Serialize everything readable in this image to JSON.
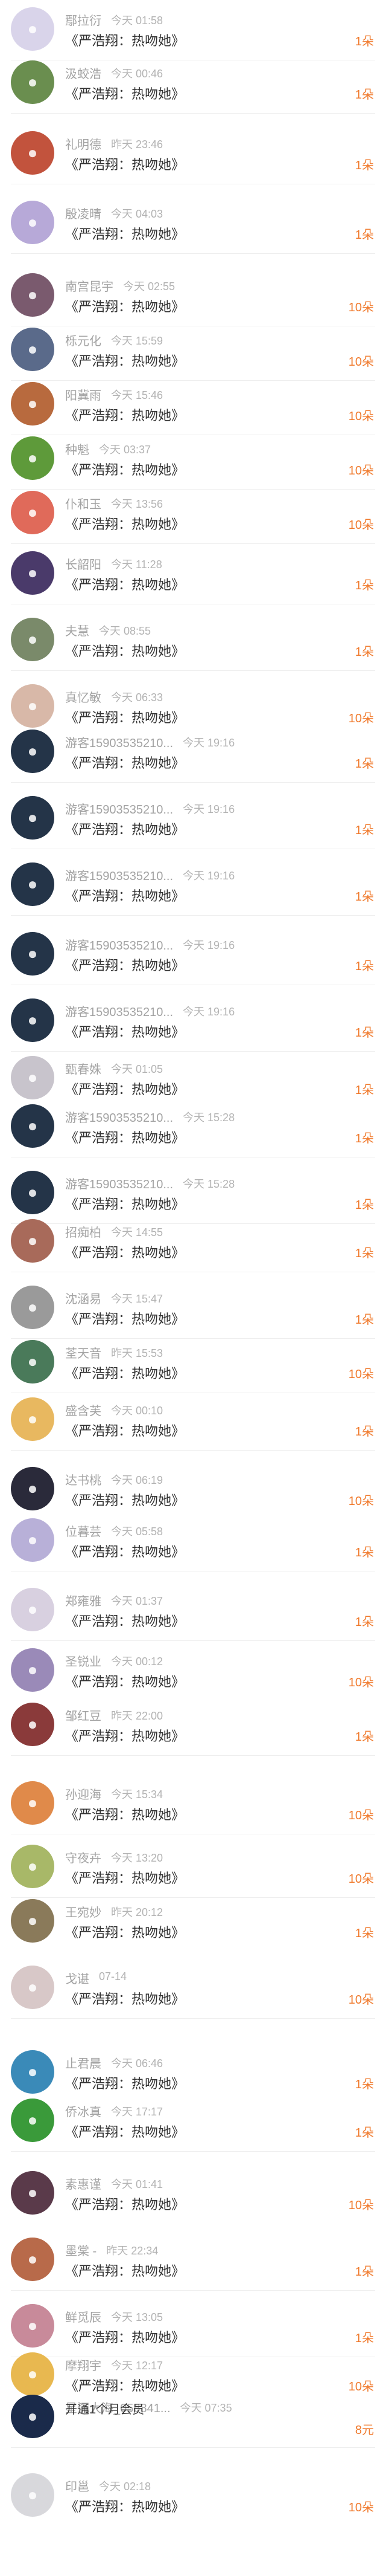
{
  "accent_color": "#f07a2d",
  "rows": [
    {
      "name": "鄢拉衍",
      "time": "今天 01:58",
      "gift": "《严浩翔：热吻她》",
      "amount": "1朵",
      "avatar_color": "#d9d4ea",
      "avatar_icon": "user-avatar"
    },
    {
      "name": "汲蛟浩",
      "time": "今天 00:46",
      "gift": "《严浩翔：热吻她》",
      "amount": "1朵",
      "avatar_color": "#6a8e4f",
      "avatar_icon": "user-avatar"
    },
    {
      "name": "礼明德",
      "time": "昨天 23:46",
      "gift": "《严浩翔：热吻她》",
      "amount": "1朵",
      "avatar_color": "#c2533d",
      "avatar_icon": "user-avatar"
    },
    {
      "name": "殷凌晴",
      "time": "今天 04:03",
      "gift": "《严浩翔：热吻她》",
      "amount": "1朵",
      "avatar_color": "#b7a9d8",
      "avatar_icon": "user-avatar"
    },
    {
      "name": "南宫昆宇",
      "time": "今天 02:55",
      "gift": "《严浩翔：热吻她》",
      "amount": "10朵",
      "avatar_color": "#7a5a6e",
      "avatar_icon": "user-avatar"
    },
    {
      "name": "栎元化",
      "time": "今天 15:59",
      "gift": "《严浩翔：热吻她》",
      "amount": "10朵",
      "avatar_color": "#5a6a8a",
      "avatar_icon": "user-avatar"
    },
    {
      "name": "阳冀雨",
      "time": "今天 15:46",
      "gift": "《严浩翔：热吻她》",
      "amount": "10朵",
      "avatar_color": "#b86a3e",
      "avatar_icon": "user-avatar"
    },
    {
      "name": "种魁",
      "time": "今天 03:37",
      "gift": "《严浩翔：热吻她》",
      "amount": "10朵",
      "avatar_color": "#5e9a3a",
      "avatar_icon": "user-avatar"
    },
    {
      "name": "仆和玉",
      "time": "今天 13:56",
      "gift": "《严浩翔：热吻她》",
      "amount": "10朵",
      "avatar_color": "#e06a5a",
      "avatar_icon": "user-avatar"
    },
    {
      "name": "长韶阳",
      "time": "今天 11:28",
      "gift": "《严浩翔：热吻她》",
      "amount": "1朵",
      "avatar_color": "#4a3a6a",
      "avatar_icon": "user-avatar"
    },
    {
      "name": "夫慧",
      "time": "今天 08:55",
      "gift": "《严浩翔：热吻她》",
      "amount": "1朵",
      "avatar_color": "#7a8a6a",
      "avatar_icon": "user-avatar"
    },
    {
      "name": "真忆敏",
      "time": "今天 06:33",
      "gift": "《严浩翔：热吻她》",
      "amount": "10朵",
      "avatar_color": "#d8b8a8",
      "avatar_icon": "user-avatar"
    },
    {
      "name": "游客15903535210...",
      "time": "今天 19:16",
      "gift": "《严浩翔：热吻她》",
      "amount": "1朵",
      "avatar_color": "#243448",
      "avatar_icon": "user-avatar"
    },
    {
      "name": "游客15903535210...",
      "time": "今天 19:16",
      "gift": "《严浩翔：热吻她》",
      "amount": "1朵",
      "avatar_color": "#243448",
      "avatar_icon": "user-avatar"
    },
    {
      "name": "游客15903535210...",
      "time": "今天 19:16",
      "gift": "《严浩翔：热吻她》",
      "amount": "1朵",
      "avatar_color": "#243448",
      "avatar_icon": "user-avatar"
    },
    {
      "name": "游客15903535210...",
      "time": "今天 19:16",
      "gift": "《严浩翔：热吻她》",
      "amount": "1朵",
      "avatar_color": "#243448",
      "avatar_icon": "user-avatar"
    },
    {
      "name": "游客15903535210...",
      "time": "今天 19:16",
      "gift": "《严浩翔：热吻她》",
      "amount": "1朵",
      "avatar_color": "#243448",
      "avatar_icon": "user-avatar"
    },
    {
      "name": "甄春姝",
      "time": "今天 01:05",
      "gift": "《严浩翔：热吻她》",
      "amount": "1朵",
      "avatar_color": "#c8c4cc",
      "avatar_icon": "user-avatar"
    },
    {
      "name": "游客15903535210...",
      "time": "今天 15:28",
      "gift": "《严浩翔：热吻她》",
      "amount": "1朵",
      "avatar_color": "#243448",
      "avatar_icon": "user-avatar"
    },
    {
      "name": "游客15903535210...",
      "time": "今天 15:28",
      "gift": "《严浩翔：热吻她》",
      "amount": "1朵",
      "avatar_color": "#243448",
      "avatar_icon": "user-avatar"
    },
    {
      "name": "招痴柏",
      "time": "今天 14:55",
      "gift": "《严浩翔：热吻她》",
      "amount": "1朵",
      "avatar_color": "#a86a5a",
      "avatar_icon": "user-avatar"
    },
    {
      "name": "沈涵易",
      "time": "今天 15:47",
      "gift": "《严浩翔：热吻她》",
      "amount": "1朵",
      "avatar_color": "#9a9a9a",
      "avatar_icon": "user-avatar"
    },
    {
      "name": "荃天音",
      "time": "昨天 15:53",
      "gift": "《严浩翔：热吻她》",
      "amount": "10朵",
      "avatar_color": "#4a7a5a",
      "avatar_icon": "user-avatar"
    },
    {
      "name": "盛含芙",
      "time": "今天 00:10",
      "gift": "《严浩翔：热吻她》",
      "amount": "1朵",
      "avatar_color": "#e8b860",
      "avatar_icon": "user-avatar"
    },
    {
      "name": "达书桃",
      "time": "今天 06:19",
      "gift": "《严浩翔：热吻她》",
      "amount": "10朵",
      "avatar_color": "#2a2a3a",
      "avatar_icon": "user-avatar"
    },
    {
      "name": "位暮芸",
      "time": "今天 05:58",
      "gift": "《严浩翔：热吻她》",
      "amount": "1朵",
      "avatar_color": "#b8b0d8",
      "avatar_icon": "user-avatar"
    },
    {
      "name": "郑雍雅",
      "time": "今天 01:37",
      "gift": "《严浩翔：热吻她》",
      "amount": "1朵",
      "avatar_color": "#d8d0e0",
      "avatar_icon": "user-avatar"
    },
    {
      "name": "圣锐业",
      "time": "今天 00:12",
      "gift": "《严浩翔：热吻她》",
      "amount": "10朵",
      "avatar_color": "#9a8ab8",
      "avatar_icon": "user-avatar"
    },
    {
      "name": "邹红豆",
      "time": "昨天 22:00",
      "gift": "《严浩翔：热吻她》",
      "amount": "1朵",
      "avatar_color": "#8a3a3a",
      "avatar_icon": "user-avatar"
    },
    {
      "name": "孙迎海",
      "time": "今天 15:34",
      "gift": "《严浩翔：热吻她》",
      "amount": "10朵",
      "avatar_color": "#e08a4a",
      "avatar_icon": "user-avatar"
    },
    {
      "name": "守夜卉",
      "time": "今天 13:20",
      "gift": "《严浩翔：热吻她》",
      "amount": "10朵",
      "avatar_color": "#a8b868",
      "avatar_icon": "user-avatar"
    },
    {
      "name": "王宛妙",
      "time": "昨天 20:12",
      "gift": "《严浩翔：热吻她》",
      "amount": "1朵",
      "avatar_color": "#8a7a5a",
      "avatar_icon": "user-avatar"
    },
    {
      "name": "戈谌",
      "time": "07-14",
      "gift": "《严浩翔：热吻她》",
      "amount": "10朵",
      "avatar_color": "#d8c8c8",
      "avatar_icon": "user-avatar"
    },
    {
      "name": "止君晨",
      "time": "今天 06:46",
      "gift": "《严浩翔：热吻她》",
      "amount": "1朵",
      "avatar_color": "#3a8ab8",
      "avatar_icon": "user-avatar"
    },
    {
      "name": "侨冰真",
      "time": "今天 17:17",
      "gift": "《严浩翔：热吻她》",
      "amount": "1朵",
      "avatar_color": "#3a9a3a",
      "avatar_icon": "user-avatar"
    },
    {
      "name": "素惠谨",
      "time": "今天 01:41",
      "gift": "《严浩翔：热吻她》",
      "amount": "10朵",
      "avatar_color": "#5a3a4a",
      "avatar_icon": "user-avatar"
    },
    {
      "name": "墨棠 -",
      "time": "昨天 22:34",
      "gift": "《严浩翔：热吻她》",
      "amount": "1朵",
      "avatar_color": "#b86a4a",
      "avatar_icon": "user-avatar"
    },
    {
      "name": "鲜觅辰",
      "time": "今天 13:05",
      "gift": "《严浩翔：热吻她》",
      "amount": "1朵",
      "avatar_color": "#c88a9a",
      "avatar_icon": "user-avatar"
    },
    {
      "name": "摩翔宇",
      "time": "今天 12:17",
      "gift": "《严浩翔：热吻她》",
      "amount": "10朵",
      "avatar_color": "#e8b850",
      "avatar_icon": "user-avatar"
    },
    {
      "name": "星沉大海_056841...",
      "time": "今天 07:35",
      "gift": "开通1个月会员",
      "amount": "8元",
      "avatar_color": "#1a2a4a",
      "avatar_icon": "user-avatar"
    },
    {
      "name": "印邕",
      "time": "今天 02:18",
      "gift": "《严浩翔：热吻她》",
      "amount": "10朵",
      "avatar_color": "#d8d8dc",
      "avatar_icon": "user-avatar"
    }
  ]
}
